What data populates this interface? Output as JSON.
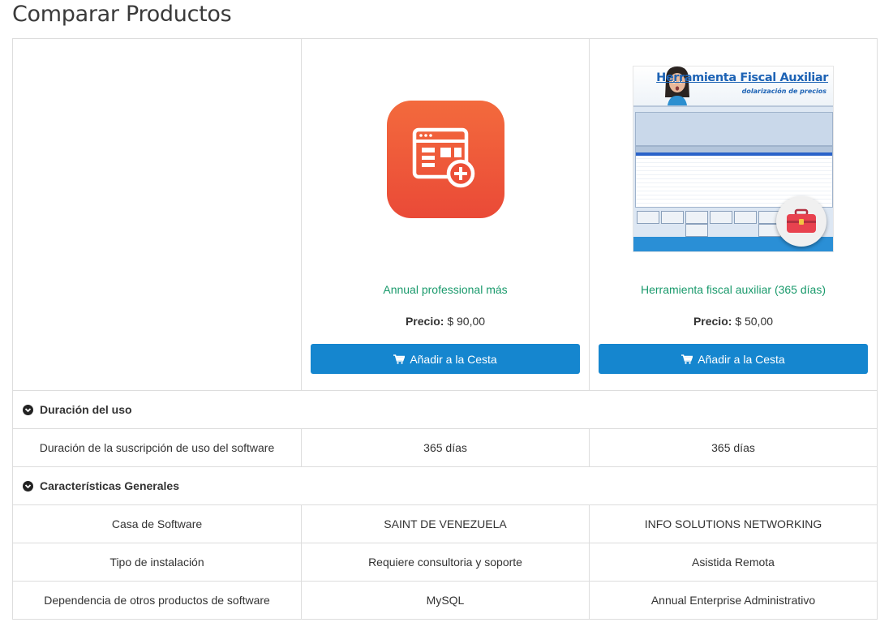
{
  "page": {
    "title": "Comparar Productos"
  },
  "products": [
    {
      "name": "Annual professional más",
      "price_label": "Precio:",
      "price_value": "$ 90,00",
      "button_label": "Añadir a la Cesta",
      "image": "app-form-plus-icon"
    },
    {
      "name": "Herramienta fiscal auxiliar (365 días)",
      "price_label": "Precio:",
      "price_value": "$ 50,00",
      "button_label": "Añadir a la Cesta",
      "image": "software-screenshot",
      "image_text": {
        "title": "Herramienta Fiscal Auxiliar",
        "subtitle": "dolarización de precios"
      }
    }
  ],
  "sections": [
    {
      "title": "Duración del uso",
      "rows": [
        {
          "label": "Duración de la suscripción de uso del software",
          "values": [
            "365 días",
            "365 días"
          ]
        }
      ]
    },
    {
      "title": "Características Generales",
      "rows": [
        {
          "label": "Casa de Software",
          "values": [
            "SAINT DE VENEZUELA",
            "INFO SOLUTIONS NETWORKING"
          ]
        },
        {
          "label": "Tipo de instalación",
          "values": [
            "Requiere consultoria y soporte",
            "Asistida Remota"
          ]
        },
        {
          "label": "Dependencia de otros productos de software",
          "values": [
            "MySQL",
            "Annual Enterprise Administrativo"
          ]
        }
      ]
    }
  ],
  "icons": {
    "cart": "shopping-cart-icon",
    "section_toggle": "chevron-circle-down-icon"
  },
  "colors": {
    "button": "#1586cf",
    "product_name": "#1a9a6c",
    "app_icon": "#ee5538",
    "border": "#dddddd"
  }
}
